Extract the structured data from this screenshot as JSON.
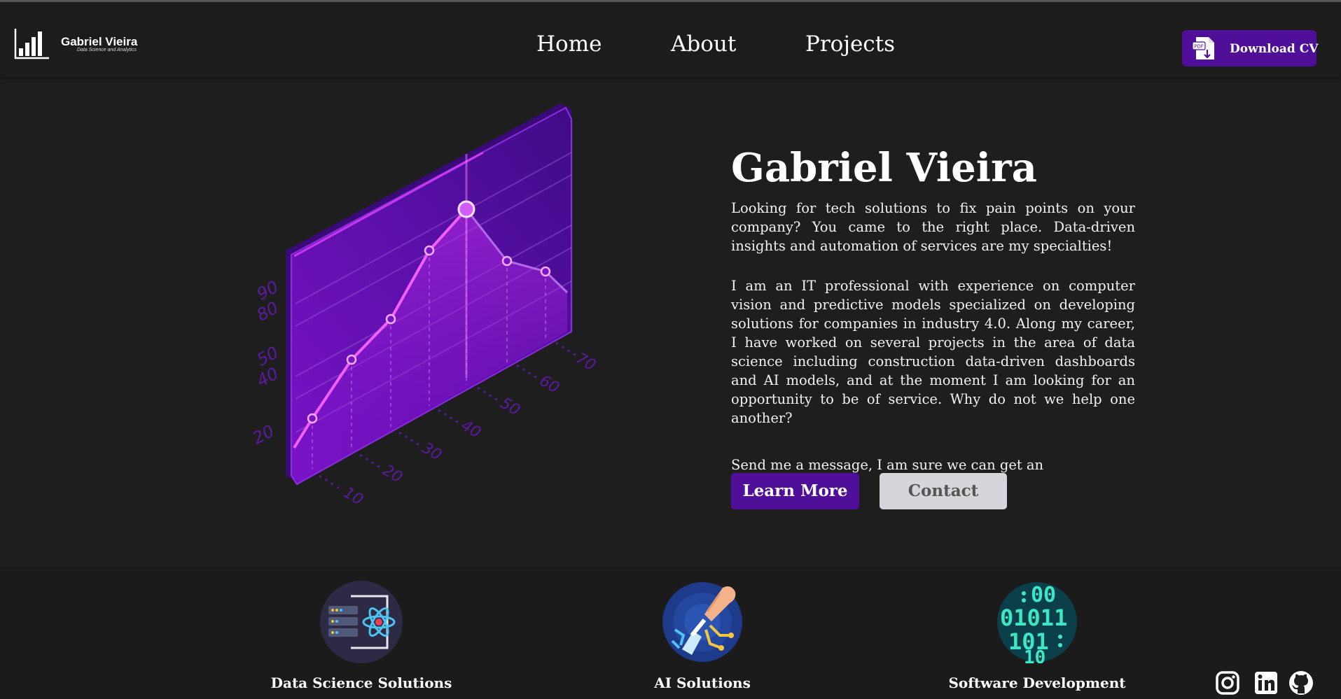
{
  "header": {
    "logo_name": "Gabriel Vieira",
    "logo_tagline": "Data Science and Analytics",
    "nav": [
      "Home",
      "About",
      "Projects"
    ],
    "download_cv_label": "Download CV"
  },
  "hero": {
    "title": "Gabriel Vieira",
    "paragraph1": "Looking for tech solutions to fix pain points on your company? You came to the right place. Data-driven insights and automation of services are my specialties!",
    "paragraph2": "I am an IT professional with experience on computer vision and predictive models specialized on developing solutions for companies in industry 4.0. Along my career, I have worked on several projects in the area of data science including construction data-driven dashboards and AI models, and at the moment I am looking for an opportunity to be of service. Why do not we help one another?",
    "paragraph3": "Send me a message, I am sure we can get an arrangement.",
    "learn_more_label": "Learn More",
    "contact_label": "Contact",
    "illustration": {
      "y_ticks": [
        "20",
        "40",
        "50",
        "80",
        "90"
      ],
      "x_ticks": [
        "10",
        "20",
        "30",
        "40",
        "50",
        "60",
        "70"
      ]
    }
  },
  "services": [
    {
      "label": "Data Science Solutions",
      "icon": "data-science-icon"
    },
    {
      "label": "AI Solutions",
      "icon": "ai-hand-icon"
    },
    {
      "label": "Software Development",
      "icon": "binary-code-icon"
    }
  ],
  "social": [
    "instagram-icon",
    "linkedin-icon",
    "github-icon"
  ],
  "colors": {
    "background": "#1e1e1e",
    "accent_purple": "#4f0f99",
    "contact_button": "#d4d6dc"
  }
}
